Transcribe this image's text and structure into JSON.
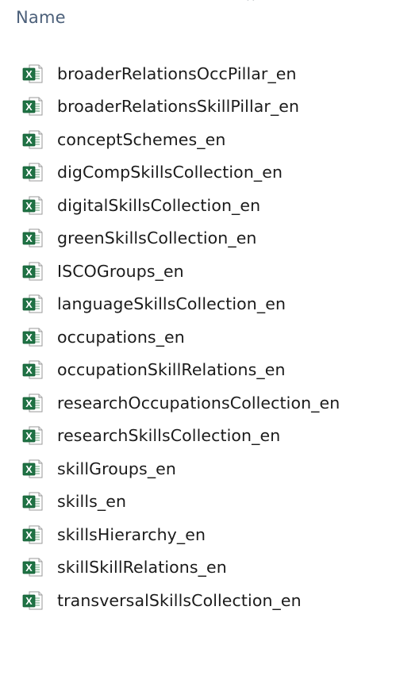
{
  "header": {
    "name_label": "Name",
    "sort_indicator": "^"
  },
  "colors": {
    "header_text": "#4c607a",
    "excel_green": "#1f7244",
    "file_text": "#1b1b1b"
  },
  "files": [
    {
      "name": "broaderRelationsOccPillar_en",
      "icon": "excel-csv-icon"
    },
    {
      "name": "broaderRelationsSkillPillar_en",
      "icon": "excel-csv-icon"
    },
    {
      "name": "conceptSchemes_en",
      "icon": "excel-csv-icon"
    },
    {
      "name": "digCompSkillsCollection_en",
      "icon": "excel-csv-icon"
    },
    {
      "name": "digitalSkillsCollection_en",
      "icon": "excel-csv-icon"
    },
    {
      "name": "greenSkillsCollection_en",
      "icon": "excel-csv-icon"
    },
    {
      "name": "ISCOGroups_en",
      "icon": "excel-csv-icon"
    },
    {
      "name": "languageSkillsCollection_en",
      "icon": "excel-csv-icon"
    },
    {
      "name": "occupations_en",
      "icon": "excel-csv-icon"
    },
    {
      "name": "occupationSkillRelations_en",
      "icon": "excel-csv-icon"
    },
    {
      "name": "researchOccupationsCollection_en",
      "icon": "excel-csv-icon"
    },
    {
      "name": "researchSkillsCollection_en",
      "icon": "excel-csv-icon"
    },
    {
      "name": "skillGroups_en",
      "icon": "excel-csv-icon"
    },
    {
      "name": "skills_en",
      "icon": "excel-csv-icon"
    },
    {
      "name": "skillsHierarchy_en",
      "icon": "excel-csv-icon"
    },
    {
      "name": "skillSkillRelations_en",
      "icon": "excel-csv-icon"
    },
    {
      "name": "transversalSkillsCollection_en",
      "icon": "excel-csv-icon"
    }
  ]
}
